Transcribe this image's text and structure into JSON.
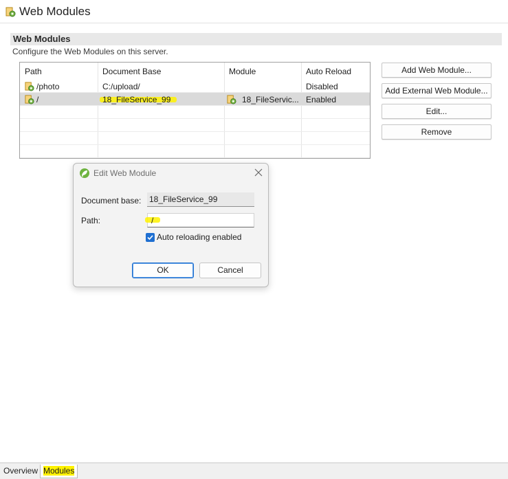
{
  "titlebar": {
    "title": "Web Modules"
  },
  "section": {
    "title": "Web Modules",
    "description": "Configure the Web Modules on this server."
  },
  "table": {
    "columns": [
      "Path",
      "Document Base",
      "Module",
      "Auto Reload"
    ],
    "rows": [
      {
        "path": "/photo",
        "document_base": "C:/upload/",
        "module": "",
        "auto_reload": "Disabled"
      },
      {
        "path": "/",
        "document_base": "18_FileService_99",
        "module": "18_FileServic...",
        "auto_reload": "Enabled"
      }
    ]
  },
  "buttons": {
    "add_web_module": "Add Web Module...",
    "add_external_web_module": "Add External Web Module...",
    "edit": "Edit...",
    "remove": "Remove"
  },
  "dialog": {
    "title": "Edit Web Module",
    "document_base_label": "Document base:",
    "document_base_value": "18_FileService_99",
    "path_label": "Path:",
    "path_value": "/",
    "auto_reload_label": "Auto reloading enabled",
    "auto_reload_checked": true,
    "ok_label": "OK",
    "cancel_label": "Cancel"
  },
  "tabs": [
    {
      "label": "Overview",
      "active": false
    },
    {
      "label": "Modules",
      "active": true
    }
  ],
  "colors": {
    "highlight": "#fff200",
    "accent": "#1f6fd1",
    "selected_row": "#dadada"
  }
}
